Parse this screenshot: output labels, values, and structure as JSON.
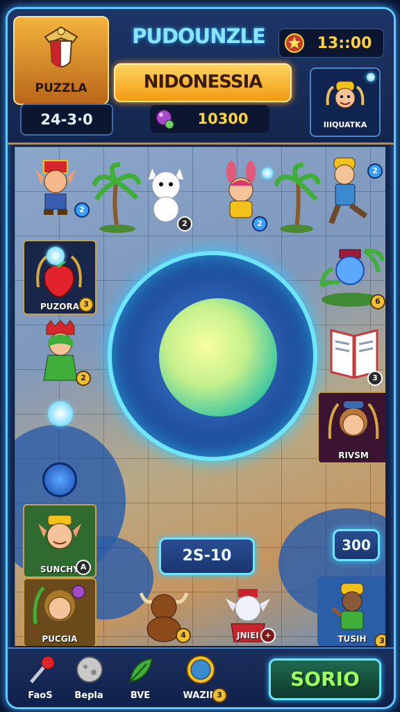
{
  "header": {
    "crest_label": "PUZZLA",
    "game_title": "PUDOUNZLE",
    "timer": "13::00",
    "level_banner": "NIDONESSIA",
    "score": "24-3·0",
    "coins": "10300",
    "player_label": "IIIQUATKA"
  },
  "board": {
    "tiles": [
      {
        "label": "PUZORA",
        "badge": "3"
      },
      {
        "label": "RIVSM"
      },
      {
        "label": "SUNCHY",
        "badge": "A"
      },
      {
        "label": "PUCGIA"
      },
      {
        "label": "JNIEI",
        "badge": "+"
      },
      {
        "label": "TUSIH",
        "badge": "3"
      }
    ],
    "badges": {
      "elf": "2",
      "cat": "2",
      "runner": "2",
      "planet": "6",
      "greenkid": "2",
      "book": "3",
      "bull": "4",
      "bunny": "2"
    },
    "center_pill": "2S-10",
    "right_pill": "300"
  },
  "footer": {
    "items": [
      {
        "label": "FaoS"
      },
      {
        "label": "Bepla"
      },
      {
        "label": "BVE"
      },
      {
        "label": "WAZIN",
        "badge": "3"
      }
    ],
    "solve_label": "SORIO"
  },
  "colors": {
    "accent_glow": "#6ee6ff",
    "gold": "#ffd23a",
    "banner": "#f29a12",
    "solve_text": "#9cff5a"
  },
  "icons": [
    "crest-emblem-icon",
    "star-icon",
    "gem-coin-icon",
    "pin-icon",
    "moon-ball-icon",
    "leaf-icon",
    "globe-medal-icon"
  ]
}
